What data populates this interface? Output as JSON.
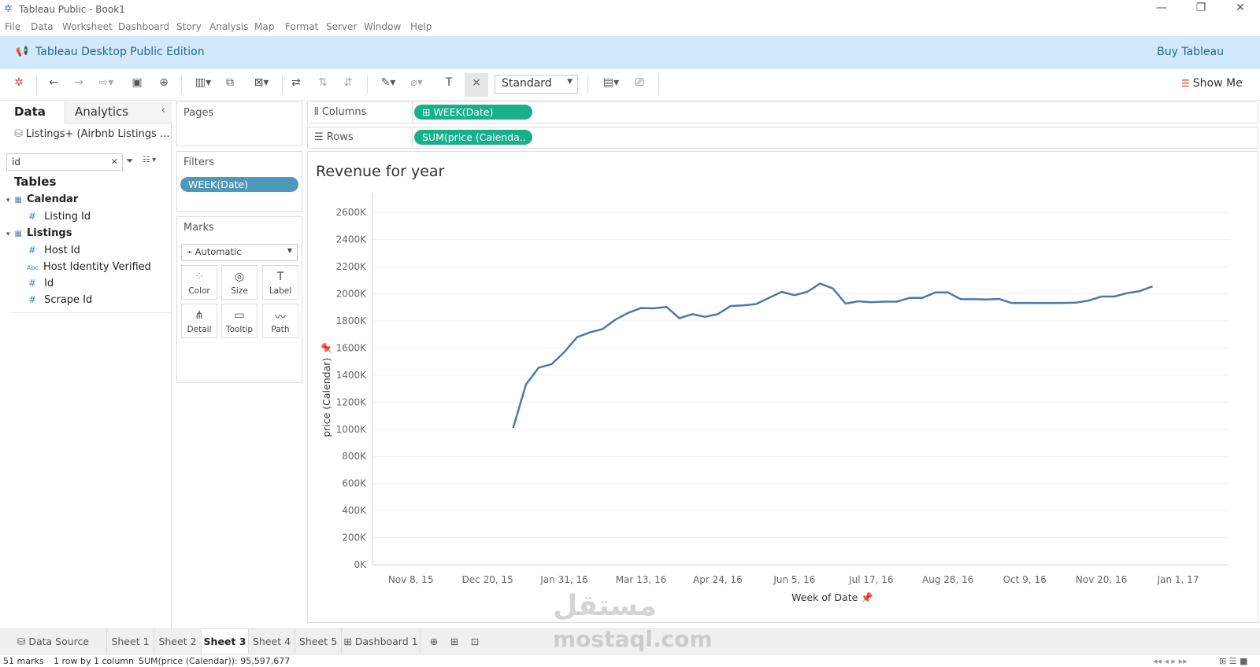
{
  "window": {
    "title": "Tableau Public - Book1"
  },
  "menu": [
    "File",
    "Data",
    "Worksheet",
    "Dashboard",
    "Story",
    "Analysis",
    "Map",
    "Format",
    "Server",
    "Window",
    "Help"
  ],
  "banner": {
    "edition": "Tableau Desktop Public Edition",
    "buy": "Buy Tableau"
  },
  "toolbar": {
    "fit": "Standard",
    "show_me": "Show Me"
  },
  "left_pane": {
    "tabs": {
      "data": "Data",
      "analytics": "Analytics"
    },
    "datasource": "Listings+ (Airbnb Listings ...",
    "search_value": "id",
    "tables_label": "Tables",
    "tree": [
      {
        "label": "Calendar"
      },
      {
        "label": "Listing Id"
      },
      {
        "label": "Listings"
      },
      {
        "label": "Host Id"
      },
      {
        "label": "Host Identity Verified"
      },
      {
        "label": "Id"
      },
      {
        "label": "Scrape Id"
      }
    ]
  },
  "pages": {
    "title": "Pages"
  },
  "filters": {
    "title": "Filters",
    "pill": "WEEK(Date)"
  },
  "marks": {
    "title": "Marks",
    "type": "Automatic",
    "buttons": [
      "Color",
      "Size",
      "Label",
      "Detail",
      "Tooltip",
      "Path"
    ]
  },
  "shelves": {
    "columns_label": "Columns",
    "columns_pill": "WEEK(Date)",
    "rows_label": "Rows",
    "rows_pill": "SUM(price (Calenda.."
  },
  "chart_data": {
    "type": "line",
    "title": "Revenue for year",
    "xlabel": "Week of Date",
    "ylabel": "price (Calendar)",
    "x_ticks": [
      "Nov 8, 15",
      "Dec 20, 15",
      "Jan 31, 16",
      "Mar 13, 16",
      "Apr 24, 16",
      "Jun 5, 16",
      "Jul 17, 16",
      "Aug 28, 16",
      "Oct 9, 16",
      "Nov 20, 16",
      "Jan 1, 17"
    ],
    "y_ticks": [
      "0K",
      "200K",
      "400K",
      "600K",
      "800K",
      "1000K",
      "1200K",
      "1400K",
      "1600K",
      "1800K",
      "2000K",
      "2200K",
      "2400K",
      "2600K"
    ],
    "ylim": [
      0,
      2700
    ],
    "y_unit": "K",
    "grid": true,
    "series": [
      {
        "x": [
          "2016-01-03",
          "2016-01-10",
          "2016-01-17",
          "2016-01-24",
          "2016-01-31",
          "2016-02-07",
          "2016-02-14",
          "2016-02-21",
          "2016-02-28",
          "2016-03-06",
          "2016-03-13",
          "2016-03-20",
          "2016-03-27",
          "2016-04-03",
          "2016-04-10",
          "2016-04-17",
          "2016-04-24",
          "2016-05-01",
          "2016-05-08",
          "2016-05-15",
          "2016-05-22",
          "2016-05-29",
          "2016-06-05",
          "2016-06-12",
          "2016-06-19",
          "2016-06-26",
          "2016-07-03",
          "2016-07-10",
          "2016-07-17",
          "2016-07-24",
          "2016-07-31",
          "2016-08-07",
          "2016-08-14",
          "2016-08-21",
          "2016-08-28",
          "2016-09-04",
          "2016-09-11",
          "2016-09-18",
          "2016-09-25",
          "2016-10-02",
          "2016-10-09",
          "2016-10-16",
          "2016-10-23",
          "2016-10-30",
          "2016-11-06",
          "2016-11-13",
          "2016-11-20",
          "2016-11-27",
          "2016-12-04",
          "2016-12-11",
          "2016-12-18"
        ],
        "values": [
          1010,
          1330,
          1455,
          1480,
          1570,
          1680,
          1715,
          1740,
          1810,
          1860,
          1895,
          1893,
          1903,
          1820,
          1850,
          1830,
          1850,
          1910,
          1915,
          1925,
          1970,
          2015,
          1990,
          2015,
          2075,
          2040,
          1928,
          1945,
          1938,
          1942,
          1942,
          1970,
          1970,
          2010,
          2010,
          1960,
          1960,
          1958,
          1962,
          1932,
          1933,
          1932,
          1932,
          1933,
          1935,
          1950,
          1980,
          1980,
          2005,
          2020,
          2055
        ]
      }
    ]
  },
  "sheet_tabs": [
    "Data Source",
    "Sheet 1",
    "Sheet 2",
    "Sheet 3",
    "Sheet 4",
    "Sheet 5",
    "Dashboard 1"
  ],
  "active_sheet": "Sheet 3",
  "status": {
    "marks": "51 marks",
    "grid": "1 row by 1 column",
    "sum": "SUM(price (Calendar)): 95,597,677"
  },
  "watermark": {
    "arabic": "مستقل",
    "latin": "mostaql.com"
  },
  "colors": {
    "line": "#4e79a7",
    "pill_green": "#18b08b",
    "pill_blue": "#4d99b7",
    "banner": "#d1e9fb"
  }
}
